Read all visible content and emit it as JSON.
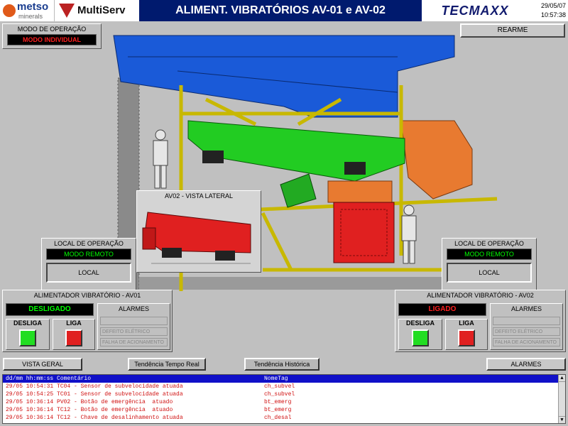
{
  "header": {
    "metso": "metso",
    "metso_sub": "minerals",
    "multiserv": "MultiServ",
    "title": "ALIMENT. VIBRATÓRIOS AV-01 e AV-02",
    "tecmaxx": "TECMAXX",
    "date": "29/05/07",
    "time": "10:57:38"
  },
  "operation_mode": {
    "title": "MODO DE OPERAÇÃO",
    "value": "MODO INDIVIDUAL"
  },
  "rearm_button": "REARME",
  "side_view": {
    "title": "AV02 - VISTA LATERAL"
  },
  "local_left": {
    "title": "LOCAL DE OPERAÇÃO",
    "mode": "MODO REMOTO",
    "button": "LOCAL"
  },
  "local_right": {
    "title": "LOCAL DE OPERAÇÃO",
    "mode": "MODO REMOTO",
    "button": "LOCAL"
  },
  "av01": {
    "title": "ALIMENTADOR VIBRATÓRIO - AV01",
    "status": "DESLIGADO",
    "off_label": "DESLIGA",
    "on_label": "LIGA",
    "alarms_title": "ALARMES",
    "alarm1": "DEFEITO ELÉTRICO",
    "alarm2": "FALHA DE ACIONAMENTO"
  },
  "av02": {
    "title": "ALIMENTADOR VIBRATÓRIO - AV02",
    "status": "LIGADO",
    "off_label": "DESLIGA",
    "on_label": "LIGA",
    "alarms_title": "ALARMES",
    "alarm1": "DEFEITO ELÉTRICO",
    "alarm2": "FALHA DE ACIONAMENTO"
  },
  "nav": {
    "vista_geral": "VISTA GERAL",
    "tend_real": "Tendência Tempo Real",
    "tend_hist": "Tendência Histórica",
    "alarmes": "ALARMES"
  },
  "alarm_list": {
    "header_left": "dd/mm hh:mm:ss Comentário",
    "header_tag": "NomeTag",
    "rows": [
      {
        "text": "29/05 10:54:31 TC04 - Sensor de subvelocidade atuada",
        "tag": "ch_subvel"
      },
      {
        "text": "29/05 10:54:25 TC01 - Sensor de subvelocidade atuada",
        "tag": "ch_subvel"
      },
      {
        "text": "29/05 10:36:14 PV02 - Botão de emergência  atuado",
        "tag": "bt_emerg"
      },
      {
        "text": "29/05 10:36:14 TC12 - Botão de emergência  atuado",
        "tag": "bt_emerg"
      },
      {
        "text": "29/05 10:36:14 TC12 - Chave de desalinhamento atuada",
        "tag": "ch_desal"
      }
    ]
  },
  "colors": {
    "header_bg": "#001a6e",
    "hopper": "#1a5ad8",
    "feeder_green": "#22cc22",
    "structure_yellow": "#e8d820",
    "chute_orange": "#e87a30",
    "side_feeder_red": "#e02020",
    "alarm_text": "#d01010"
  }
}
